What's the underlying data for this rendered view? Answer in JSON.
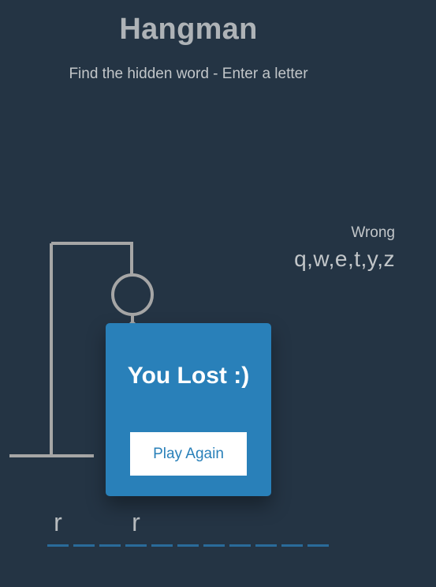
{
  "header": {
    "title": "Hangman",
    "subtitle": "Find the hidden word - Enter a letter"
  },
  "wrong": {
    "label": "Wrong",
    "letters": "q,w,e,t,y,z"
  },
  "word": {
    "slots": [
      "r",
      "",
      "",
      "r",
      "",
      "",
      "",
      "",
      "",
      "",
      ""
    ]
  },
  "popup": {
    "message": "You Lost :)",
    "button_label": "Play Again"
  },
  "colors": {
    "background": "#243444",
    "popup": "#2980b9",
    "figure": "#a6a6a6",
    "underline": "#2a6b9a"
  }
}
